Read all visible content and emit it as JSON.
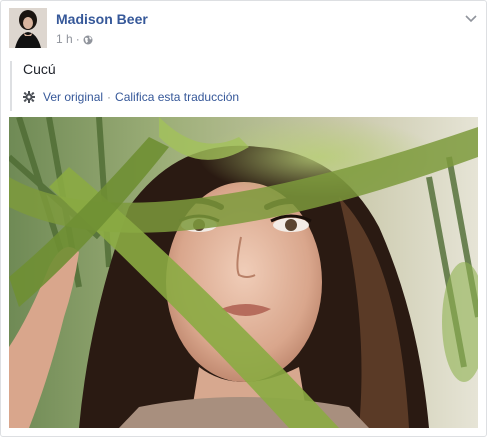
{
  "post": {
    "author_name": "Madison Beer",
    "timestamp": "1 h",
    "meta_separator": "·",
    "privacy_icon": "globe-icon",
    "menu_icon": "chevron-down-icon",
    "text": "Cucú"
  },
  "translation": {
    "settings_icon": "gear-icon",
    "see_original": "Ver original",
    "separator": "·",
    "rate_translation": "Califica esta traducción"
  },
  "colors": {
    "link": "#365899",
    "meta": "#90949c",
    "text": "#1d2129",
    "border": "#dddfe2"
  }
}
